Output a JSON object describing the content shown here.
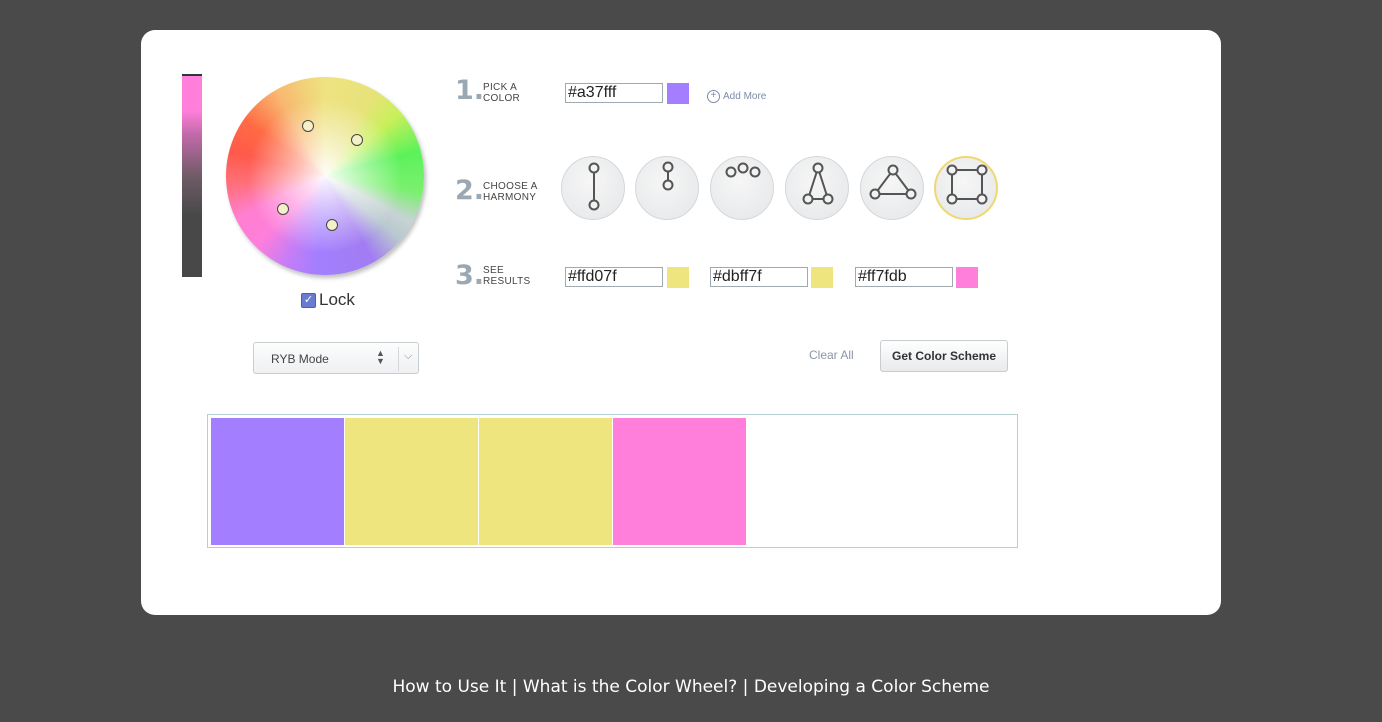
{
  "steps": {
    "pick": {
      "number": "1.",
      "label_line1": "PICK A",
      "label_line2": "COLOR"
    },
    "harmony": {
      "number": "2.",
      "label_line1": "CHOOSE A",
      "label_line2": "HARMONY"
    },
    "results": {
      "number": "3.",
      "label_line1": "SEE",
      "label_line2": "RESULTS"
    }
  },
  "base_color": {
    "hex": "#a37fff",
    "swatch": "#a37fff"
  },
  "add_more_label": "Add More",
  "lock_label": "Lock",
  "lock_checked": true,
  "harmonies": [
    {
      "name": "complementary",
      "selected": false
    },
    {
      "name": "monochromatic",
      "selected": false
    },
    {
      "name": "analogous",
      "selected": false
    },
    {
      "name": "split-complementary",
      "selected": false
    },
    {
      "name": "triadic",
      "selected": false
    },
    {
      "name": "tetradic",
      "selected": true
    }
  ],
  "results": [
    {
      "hex": "#ffd07f",
      "swatch": "#efe57f"
    },
    {
      "hex": "#dbff7f",
      "swatch": "#efe57f"
    },
    {
      "hex": "#ff7fdb",
      "swatch": "#ff7fdb"
    }
  ],
  "mode_select": {
    "selected": "RYB Mode"
  },
  "clear_all_label": "Clear All",
  "get_scheme_label": "Get Color Scheme",
  "palette": [
    "#a37fff",
    "#efe57f",
    "#efe57f",
    "#ff7fdb"
  ],
  "footer": {
    "link1": "How to Use It",
    "sep1": " | ",
    "link2": "What is the Color Wheel?",
    "sep2": " | ",
    "link3": "Developing a Color Scheme"
  }
}
